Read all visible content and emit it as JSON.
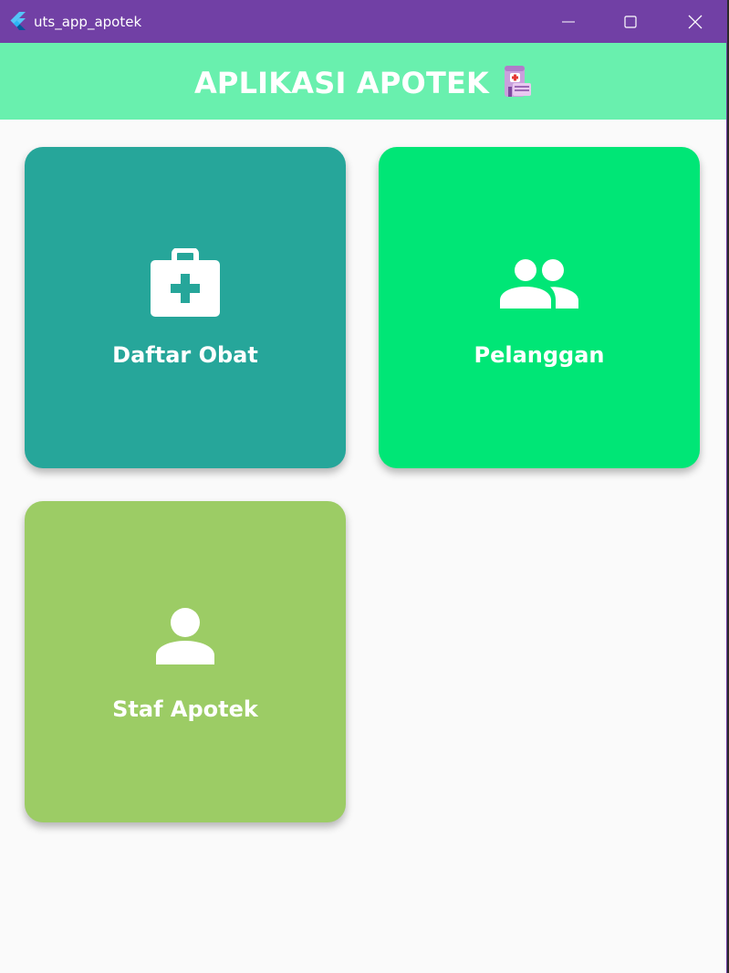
{
  "window": {
    "title": "uts_app_apotek",
    "titlebar_color": "#7140a5",
    "controls": {
      "minimize": "minimize-icon",
      "maximize": "maximize-icon",
      "close": "close-icon"
    }
  },
  "appbar": {
    "title": "APLIKASI APOTEK",
    "icon": "pharmacy-emoji-icon",
    "background": "#69f0ae"
  },
  "menu": {
    "items": [
      {
        "label": "Daftar Obat",
        "icon": "medical-kit-icon",
        "color": "#26a69a"
      },
      {
        "label": "Pelanggan",
        "icon": "people-icon",
        "color": "#00e676"
      },
      {
        "label": "Staf Apotek",
        "icon": "person-icon",
        "color": "#9ccc65"
      }
    ]
  }
}
